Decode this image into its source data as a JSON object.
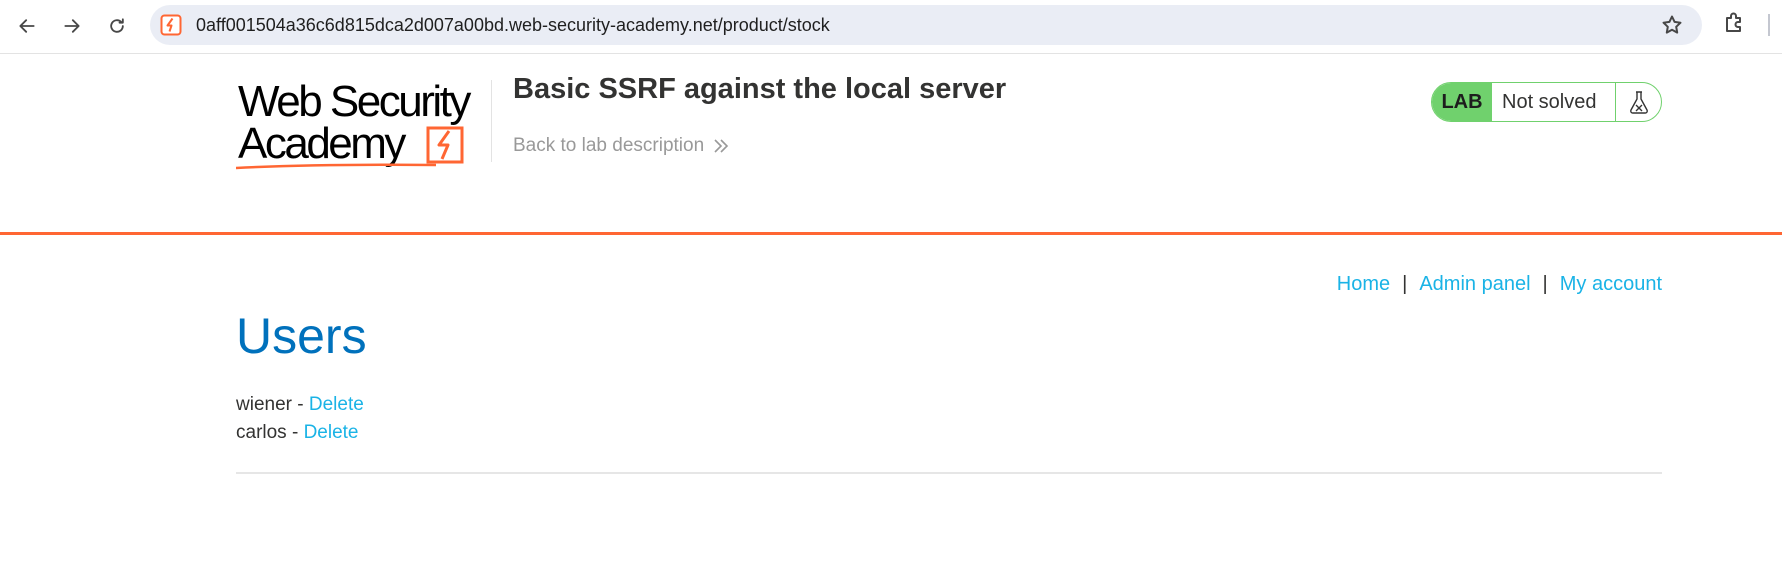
{
  "browser": {
    "url": "0aff001504a36c6d815dca2d007a00bd.web-security-academy.net/product/stock",
    "icons": [
      "back-arrow-icon",
      "forward-arrow-icon",
      "reload-icon",
      "site-favicon-icon",
      "bookmark-star-icon",
      "extensions-icon"
    ]
  },
  "lab": {
    "logo_text": "Web Security Academy",
    "title": "Basic SSRF against the local server",
    "back_link": "Back to lab description",
    "status_tag": "LAB",
    "status_text": "Not solved",
    "colors": {
      "accent": "#ff6633",
      "status_green": "#70d16d"
    }
  },
  "nav": {
    "home": "Home",
    "separator": "|",
    "admin_panel": "Admin panel",
    "my_account": "My account"
  },
  "page": {
    "title": "Users",
    "users": [
      {
        "name": "wiener",
        "separator": " - ",
        "action": "Delete"
      },
      {
        "name": "carlos",
        "separator": " - ",
        "action": "Delete"
      }
    ],
    "colors": {
      "title": "#0071bc",
      "link": "#1ab3e6"
    }
  }
}
